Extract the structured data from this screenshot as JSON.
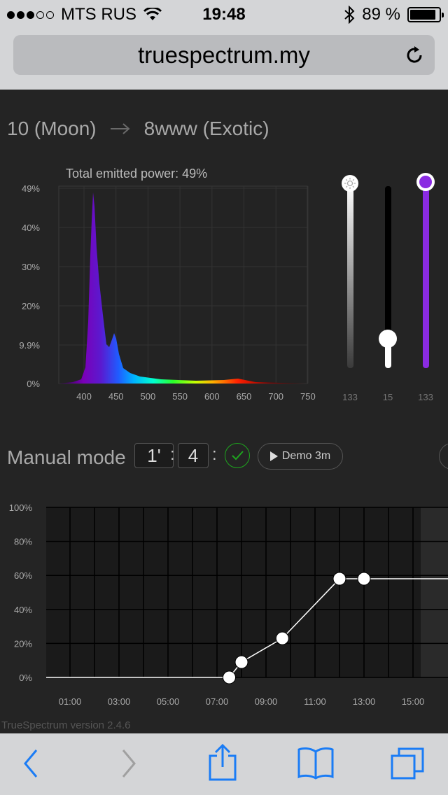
{
  "status": {
    "carrier": "MTS RUS",
    "time": "19:48",
    "battery": "89 %",
    "battery_level": 0.89
  },
  "browser": {
    "url": "truespectrum.my"
  },
  "header": {
    "from": "10 (Moon)",
    "to": "8www (Exotic)"
  },
  "spectrum": {
    "power_label": "Total emitted power: 49%",
    "y_ticks": [
      "49%",
      "40%",
      "30%",
      "20%",
      "9.9%",
      "0%"
    ],
    "x_ticks": [
      "400",
      "450",
      "500",
      "550",
      "600",
      "650",
      "700",
      "750"
    ]
  },
  "sliders": [
    {
      "name": "white",
      "label": "133",
      "level": 1.0,
      "color": "#ffffff"
    },
    {
      "name": "dark",
      "label": "15",
      "level": 0.11,
      "color": "#000000"
    },
    {
      "name": "violet",
      "label": "133",
      "level": 1.0,
      "color": "#8a2be2"
    }
  ],
  "manual": {
    "title": "Manual mode",
    "hour": "1'",
    "minute": "4",
    "demo_label": "Demo 3m"
  },
  "chart_data": {
    "type": "line",
    "x_ticks": [
      "01:00",
      "03:00",
      "05:00",
      "07:00",
      "09:00",
      "11:00",
      "13:00",
      "15:00"
    ],
    "y_ticks": [
      "100%",
      "80%",
      "60%",
      "40%",
      "20%",
      "0%"
    ],
    "ylim": [
      0,
      100
    ],
    "points": [
      {
        "x": "07:30",
        "y": 0
      },
      {
        "x": "08:00",
        "y": 9
      },
      {
        "x": "09:40",
        "y": 23
      },
      {
        "x": "12:00",
        "y": 58
      },
      {
        "x": "13:00",
        "y": 58
      }
    ],
    "grid": true
  },
  "footer": {
    "version": "TrueSpectrum version 2.4.6"
  },
  "colors": {
    "background": "#242424",
    "accent_violet": "#8a2be2",
    "ok_green": "#1ea51e"
  }
}
